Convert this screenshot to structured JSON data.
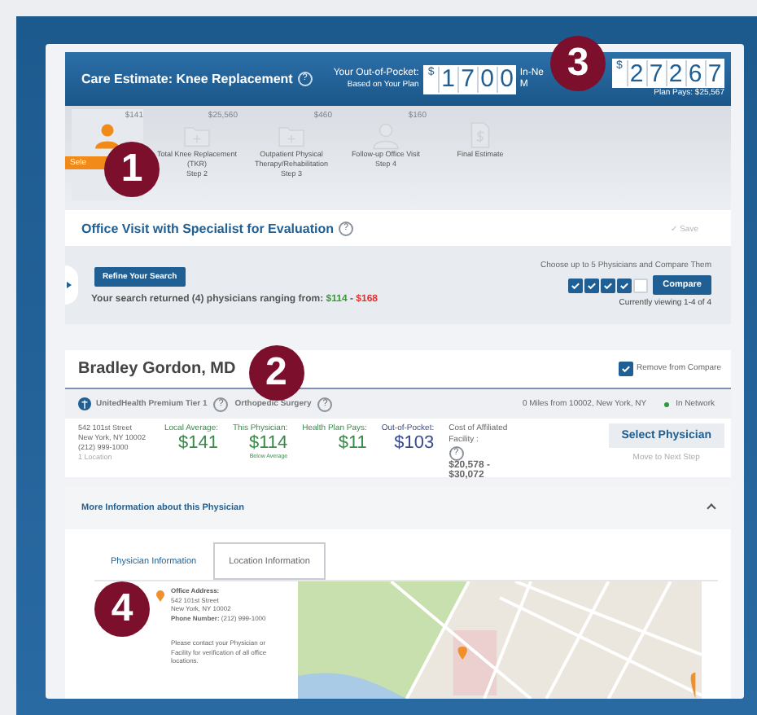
{
  "header": {
    "title": "Care Estimate: Knee Replacement",
    "help": "?",
    "oop_label": "Your Out-of-Pocket:",
    "oop_sub": "Based on Your Plan",
    "currency": "$",
    "oop_digits": [
      "1",
      "7",
      "0",
      "0"
    ],
    "network_label": "In-Ne",
    "network_sub": "M",
    "total_digits": [
      "2",
      "7",
      "2",
      "6",
      "7"
    ],
    "plan_pays": "Plan Pays: $25,567"
  },
  "callouts": [
    {
      "number": "1"
    },
    {
      "number": "2"
    },
    {
      "number": "3"
    },
    {
      "number": "4"
    }
  ],
  "steps": [
    {
      "kind": "person",
      "price": "$141",
      "selected": true,
      "ribbon": "Sele"
    },
    {
      "kind": "folder",
      "price": "$25,560",
      "selected": false,
      "label": "Total Knee Replacement (TKR)",
      "step": "Step 2"
    },
    {
      "kind": "folder",
      "price": "$460",
      "selected": false,
      "label": "Outpatient Physical Therapy/Rehabilitation",
      "step": "Step 3"
    },
    {
      "kind": "person",
      "price": "$160",
      "selected": false,
      "label": "Follow-up Office Visit",
      "step": "Step 4"
    },
    {
      "kind": "document",
      "selected": false,
      "label": "Final Estimate"
    }
  ],
  "section": {
    "title": "Office Visit with Specialist for Evaluation",
    "save": "✓ Save",
    "help": "?"
  },
  "search": {
    "refine_button": "Refine Your Search",
    "result_text": "Your search returned (4) physicians ranging from:",
    "low": "$114",
    "separator": "-",
    "high": "$168",
    "compare_hint": "Choose up to 5 Physicians and Compare Them",
    "compare_boxes": [
      {
        "checked": true
      },
      {
        "checked": true
      },
      {
        "checked": true
      },
      {
        "checked": true
      },
      {
        "checked": false
      }
    ],
    "compare_button": "Compare",
    "viewing": "Currently viewing 1-4 of 4"
  },
  "physician": {
    "name": "Bradley Gordon, MD",
    "compare": {
      "label": "Remove from Compare",
      "checked": true
    },
    "plan": "UnitedHealth Premium Tier 1",
    "plan_help": "?",
    "specialty": "Orthopedic Surgery",
    "specialty_help": "?",
    "distance": "0 Miles from 10002, New York, NY",
    "network": "In Network",
    "address": [
      "542 101st Street",
      "New York, NY 10002",
      "(212) 999-1000"
    ],
    "locations": "1 Location",
    "costs": [
      {
        "label": "Local Average:",
        "amount": "$141",
        "color": "#3a8a4a"
      },
      {
        "label": "This Physician:",
        "amount": "$114",
        "note": "Below Average",
        "color": "#3a8a4a"
      },
      {
        "label": "Health Plan Pays:",
        "amount": "$11",
        "color": "#3a8a4a"
      },
      {
        "label": "Out-of-Pocket:",
        "amount": "$103",
        "color": "#3b4a8c"
      }
    ],
    "facility": {
      "label": "Cost of Affiliated Facility :",
      "help": "?",
      "range": [
        "$20,578 -",
        "$30,072"
      ]
    },
    "select_button": "Select Physician",
    "next_step": "Move to Next Step"
  },
  "more_info": {
    "title": "More Information about this Physician",
    "expanded": true
  },
  "tabs": [
    {
      "label": "Physician Information",
      "selected": false
    },
    {
      "label": "Location Information",
      "selected": true
    }
  ],
  "location": {
    "address_label": "Office Address:",
    "address": [
      "542 101st Street",
      "New York, NY 10002"
    ],
    "phone_label": "Phone Number:",
    "phone": "(212) 999-1000",
    "note": "Please contact your Physician or Facility for verification of all office locations."
  }
}
